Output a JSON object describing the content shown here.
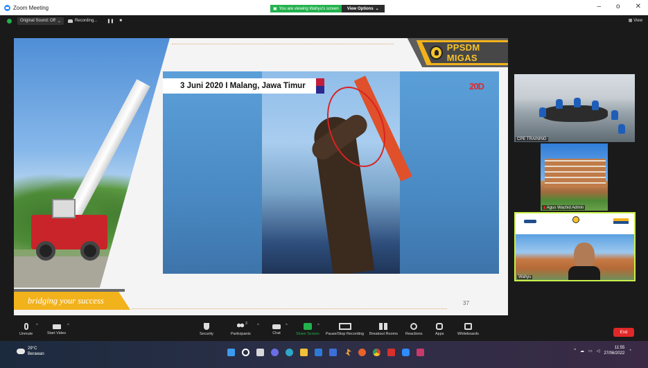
{
  "window": {
    "title": "Zoom Meeting",
    "viewing_text": "You are viewing Wahyu's screen",
    "view_options": "View Options",
    "minimize": "–",
    "maximize": "o",
    "close": "✕"
  },
  "meeting_bar": {
    "original_sound": "Original Sound: Off",
    "recording": "Recording...",
    "pause": "❚❚",
    "stop": "■",
    "view": "View"
  },
  "slide": {
    "brand": "PPSDM MIGAS",
    "caption": "3 Juni 2020 I Malang, Jawa Timur",
    "badge": "20D",
    "tagline": "bridging your success",
    "page_number": "37"
  },
  "participants": [
    {
      "label": "CPE TRAINING"
    },
    {
      "label": "Agus Wachid Admin"
    },
    {
      "label": "Wahyu"
    }
  ],
  "toolbar": {
    "items": [
      {
        "label": "Unmute",
        "icon": "mic-muted-icon"
      },
      {
        "label": "Start Video",
        "icon": "video-off-icon"
      },
      {
        "label": "Security",
        "icon": "shield-icon"
      },
      {
        "label": "Participants",
        "icon": "participants-icon",
        "count": "3"
      },
      {
        "label": "Chat",
        "icon": "chat-icon"
      },
      {
        "label": "Share Screen",
        "icon": "share-screen-icon"
      },
      {
        "label": "Pause/Stop Recording",
        "icon": "recording-icon"
      },
      {
        "label": "Breakout Rooms",
        "icon": "breakout-icon"
      },
      {
        "label": "Reactions",
        "icon": "reactions-icon"
      },
      {
        "label": "Apps",
        "icon": "apps-icon"
      },
      {
        "label": "Whiteboards",
        "icon": "whiteboard-icon"
      }
    ],
    "end": "End"
  },
  "taskbar": {
    "temp": "29°C",
    "weather": "Berawan",
    "time": "11:55",
    "date": "27/06/2022"
  },
  "colors": {
    "accent_yellow": "#f2b21c",
    "zoom_green": "#23b14d",
    "end_red": "#e02828",
    "active_border": "#c9f04a"
  }
}
